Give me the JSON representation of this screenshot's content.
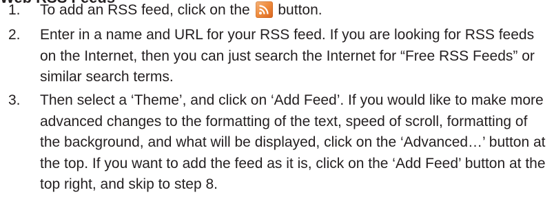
{
  "heading": "Web RSS Feeds",
  "steps": [
    {
      "number": "1.",
      "before_icon": "To add an RSS feed, click on the",
      "icon": "rss-icon",
      "after_icon": "button."
    },
    {
      "number": "2.",
      "text": "Enter in a name and URL for your RSS feed.  If you are looking for RSS feeds on the Internet, then you can just search the Internet for “Free RSS Feeds” or similar search terms."
    },
    {
      "number": "3.",
      "text": "Then select a ‘Theme’, and click on ‘Add Feed’.  If you would like to make more advanced changes to the formatting of the text, speed of scroll, formatting of the background, and what will be displayed, click on the ‘Advanced…’ button at the top. If you want to add the feed as it is, click on the ‘Add Feed’ button at the top right, and skip to step 8."
    }
  ],
  "colors": {
    "text": "#231f20",
    "rss_icon": "#ee8a3c"
  }
}
